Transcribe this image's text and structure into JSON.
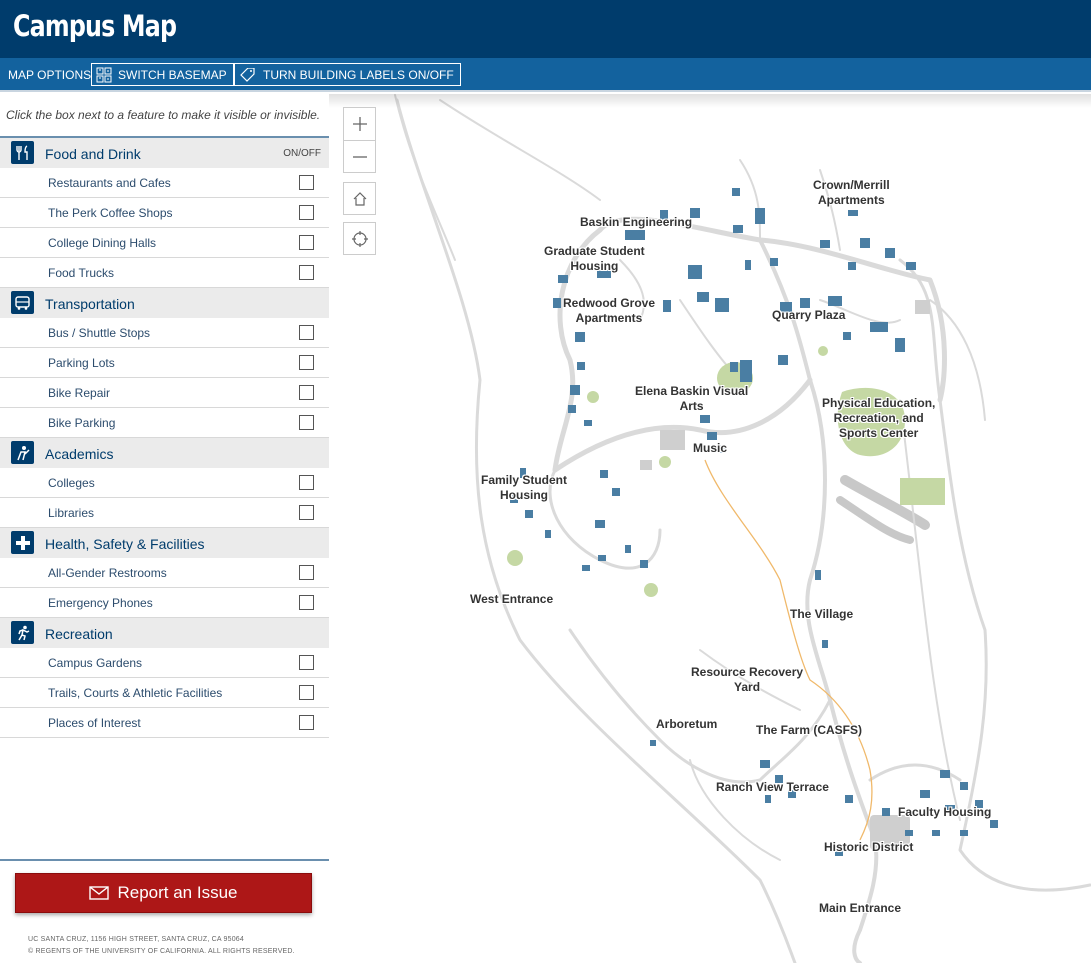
{
  "header": {
    "title": "Campus Map"
  },
  "toolbar": {
    "label": "MAP OPTIONS",
    "basemap_label": "SWITCH BASEMAP",
    "labels_label": "TURN BUILDING LABELS ON/OFF"
  },
  "sidebar": {
    "hint": "Click the box next to a feature to make it visible or invisible.",
    "onoff": "ON/OFF",
    "categories": [
      {
        "name": "Food and Drink",
        "icon": "utensils-icon",
        "items": [
          "Restaurants and Cafes",
          "The Perk Coffee Shops",
          "College Dining Halls",
          "Food Trucks"
        ]
      },
      {
        "name": "Transportation",
        "icon": "bus-icon",
        "items": [
          "Bus / Shuttle Stops",
          "Parking Lots",
          "Bike Repair",
          "Bike Parking"
        ]
      },
      {
        "name": "Academics",
        "icon": "reader-icon",
        "items": [
          "Colleges",
          "Libraries"
        ]
      },
      {
        "name": "Health, Safety & Facilities",
        "icon": "medical-cross-icon",
        "items": [
          "All-Gender Restrooms",
          "Emergency Phones"
        ]
      },
      {
        "name": "Recreation",
        "icon": "runner-icon",
        "items": [
          "Campus Gardens",
          "Trails, Courts & Athletic Facilities",
          "Places of Interest"
        ]
      }
    ],
    "report_label": "Report an Issue",
    "footer_address": "UC SANTA CRUZ, 1156 HIGH STREET, SANTA CRUZ, CA 95064",
    "footer_copyright": "© REGENTS OF THE UNIVERSITY OF CALIFORNIA. ALL RIGHTS RESERVED."
  },
  "map": {
    "labels": {
      "crown_merrill": [
        "Crown/Merrill",
        "Apartments"
      ],
      "baskin": [
        "Baskin Engineering"
      ],
      "grad_housing": [
        "Graduate Student",
        "Housing"
      ],
      "redwood": [
        "Redwood Grove",
        "Apartments"
      ],
      "quarry": [
        "Quarry Plaza"
      ],
      "elena": [
        "Elena Baskin Visual",
        "Arts"
      ],
      "music": [
        "Music"
      ],
      "opers": [
        "Physical Education,",
        "Recreation, and",
        "Sports Center"
      ],
      "family": [
        "Family Student",
        "Housing"
      ],
      "west": [
        "West Entrance"
      ],
      "village": [
        "The Village"
      ],
      "resource": [
        "Resource Recovery",
        "Yard"
      ],
      "arboretum": [
        "Arboretum"
      ],
      "farm": [
        "The Farm (CASFS)"
      ],
      "ranch": [
        "Ranch View Terrace"
      ],
      "faculty": [
        "Faculty Housing"
      ],
      "historic": [
        "Historic District"
      ],
      "main": [
        "Main Entrance"
      ]
    }
  },
  "colors": {
    "header_bg": "#003c6c",
    "toolbar_bg": "#13629e",
    "report_bg": "#ad1717",
    "building": "#4a7ea3",
    "green_space": "#c5d8a4",
    "road": "#d9d9d9",
    "trail": "#f0b96b"
  }
}
